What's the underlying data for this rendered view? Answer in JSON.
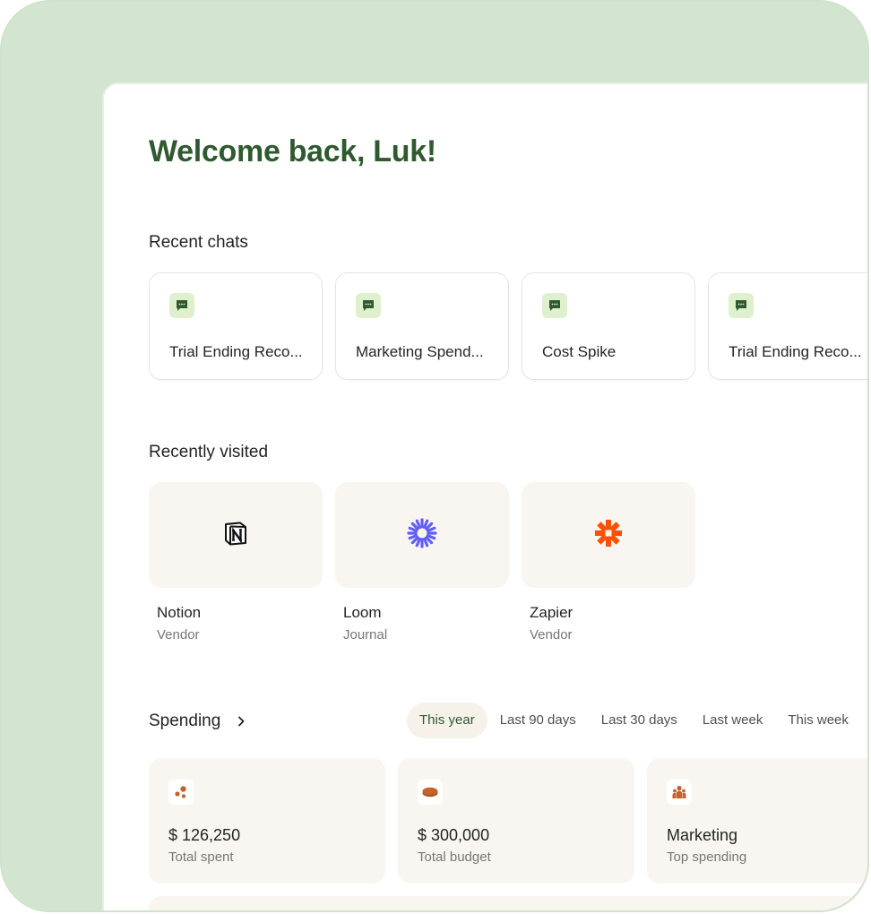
{
  "welcome": "Welcome back, Luk!",
  "recent_chats": {
    "title": "Recent chats",
    "items": [
      {
        "label": "Trial Ending Reco..."
      },
      {
        "label": "Marketing Spend..."
      },
      {
        "label": "Cost Spike"
      },
      {
        "label": "Trial Ending Reco..."
      }
    ]
  },
  "recently_visited": {
    "title": "Recently visited",
    "items": [
      {
        "name": "Notion",
        "type": "Vendor",
        "icon": "notion-logo"
      },
      {
        "name": "Loom",
        "type": "Journal",
        "icon": "loom-logo"
      },
      {
        "name": "Zapier",
        "type": "Vendor",
        "icon": "zapier-logo"
      }
    ]
  },
  "spending": {
    "title": "Spending",
    "filters": [
      "This year",
      "Last 90 days",
      "Last 30 days",
      "Last week",
      "This week"
    ],
    "active_filter": "This year",
    "stats": [
      {
        "value": "$ 126,250",
        "label": "Total spent",
        "icon": "dots-icon"
      },
      {
        "value": "$ 300,000",
        "label": "Total budget",
        "icon": "coin-stack-icon"
      },
      {
        "value": "Marketing",
        "label": "Top spending",
        "icon": "team-icon"
      }
    ]
  },
  "colors": {
    "frame": "#d3e5d1",
    "heading": "#2f5a2f",
    "chat_icon_bg": "#dff0cf",
    "tile_bg": "#f9f6f1",
    "loom": "#625df5",
    "zapier": "#ff4f00",
    "stat_icon": "#c4622d"
  }
}
